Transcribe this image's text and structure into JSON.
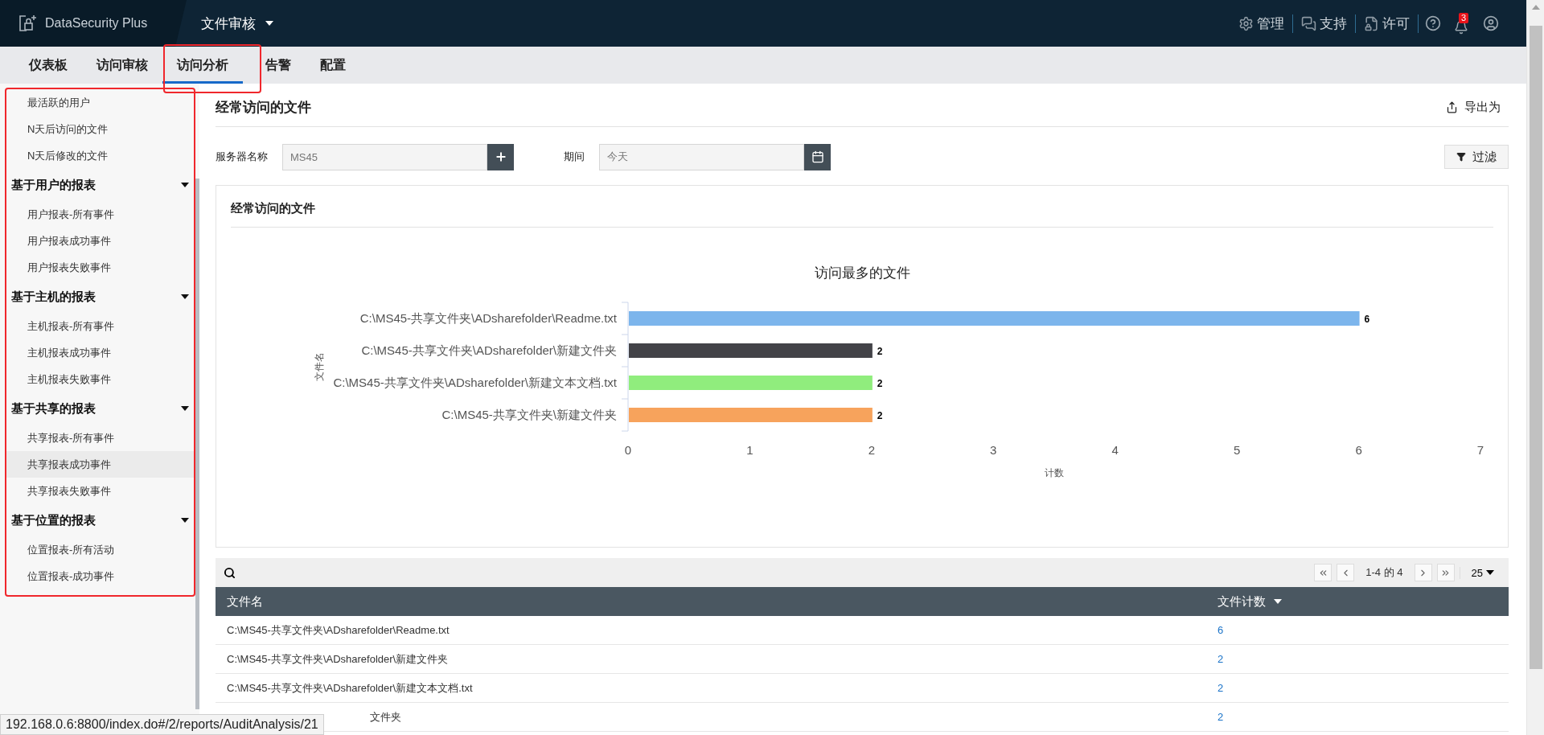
{
  "app": {
    "logo": "DataSecurity Plus",
    "module": "文件审核"
  },
  "header_actions": [
    {
      "kind": "admin",
      "label": "管理"
    },
    {
      "kind": "support",
      "label": "支持"
    },
    {
      "kind": "license",
      "label": "许可"
    }
  ],
  "notifications_badge": "3",
  "tabs": [
    {
      "label": "仪表板",
      "selected": false
    },
    {
      "label": "访问审核",
      "selected": false
    },
    {
      "label": "访问分析",
      "selected": true
    },
    {
      "label": "告警",
      "selected": false
    },
    {
      "label": "配置",
      "selected": false
    }
  ],
  "sidebar": {
    "items": [
      {
        "label": "最活跃的用户",
        "selected": false
      },
      {
        "label": "N天后访问的文件",
        "selected": false
      },
      {
        "label": "N天后修改的文件",
        "selected": false
      }
    ],
    "groups": [
      {
        "label": "基于用户的报表",
        "expanded": true,
        "children": [
          {
            "label": "用户报表-所有事件",
            "selected": false
          },
          {
            "label": "用户报表成功事件",
            "selected": false
          },
          {
            "label": "用户报表失败事件",
            "selected": false
          }
        ]
      },
      {
        "label": "基于主机的报表",
        "expanded": true,
        "children": [
          {
            "label": "主机报表-所有事件",
            "selected": false
          },
          {
            "label": "主机报表成功事件",
            "selected": false
          },
          {
            "label": "主机报表失败事件",
            "selected": false
          }
        ]
      },
      {
        "label": "基于共享的报表",
        "expanded": true,
        "children": [
          {
            "label": "共享报表-所有事件",
            "selected": false
          },
          {
            "label": "共享报表成功事件",
            "selected": true
          },
          {
            "label": "共享报表失败事件",
            "selected": false
          }
        ]
      },
      {
        "label": "基于位置的报表",
        "expanded": true,
        "children": [
          {
            "label": "位置报表-所有活动",
            "selected": false
          },
          {
            "label": "位置报表-成功事件",
            "selected": false
          }
        ]
      }
    ]
  },
  "page": {
    "title": "经常访问的文件",
    "export": "导出为"
  },
  "filters": {
    "server_label": "服务器名称",
    "server_value": "MS45",
    "period_label": "期间",
    "period_value": "今天",
    "filter_button": "过滤"
  },
  "chart_card": {
    "title": "经常访问的文件",
    "chart_data": {
      "type": "bar",
      "orientation": "horizontal",
      "title": "访问最多的文件",
      "xlabel": "计数",
      "ylabel": "文件名",
      "categories": [
        "C:\\MS45-共享文件夹\\ADsharefolder\\Readme.txt",
        "C:\\MS45-共享文件夹\\ADsharefolder\\新建文件夹",
        "C:\\MS45-共享文件夹\\ADsharefolder\\新建文本文档.txt",
        "C:\\MS45-共享文件夹\\新建文件夹"
      ],
      "series": [
        {
          "color": "#7cb5ec",
          "values": [
            6,
            null,
            null,
            null
          ]
        },
        {
          "color": "#434348",
          "values": [
            null,
            2,
            null,
            null
          ]
        },
        {
          "color": "#90ed7d",
          "values": [
            null,
            null,
            2,
            null
          ]
        },
        {
          "color": "#f7a35c",
          "values": [
            null,
            null,
            null,
            2
          ]
        }
      ],
      "xlim": [
        0,
        7
      ],
      "xticks": [
        0,
        1,
        2,
        3,
        4,
        5,
        6,
        7
      ],
      "data_labels": true
    }
  },
  "table": {
    "pager": {
      "range": "1-4 的 4",
      "page_size": "25"
    },
    "columns": [
      {
        "label": "文件名",
        "sorted": false
      },
      {
        "label": "文件计数",
        "sorted": true
      }
    ],
    "rows": [
      {
        "file": "C:\\MS45-共享文件夹\\ADsharefolder\\Readme.txt",
        "count": "6"
      },
      {
        "file": "C:\\MS45-共享文件夹\\ADsharefolder\\新建文件夹",
        "count": "2"
      },
      {
        "file": "C:\\MS45-共享文件夹\\ADsharefolder\\新建文本文档.txt",
        "count": "2"
      },
      {
        "file": "文件夹",
        "count": "2"
      }
    ]
  },
  "status_url": "192.168.0.6:8800/index.do#/2/reports/AuditAnalysis/21"
}
